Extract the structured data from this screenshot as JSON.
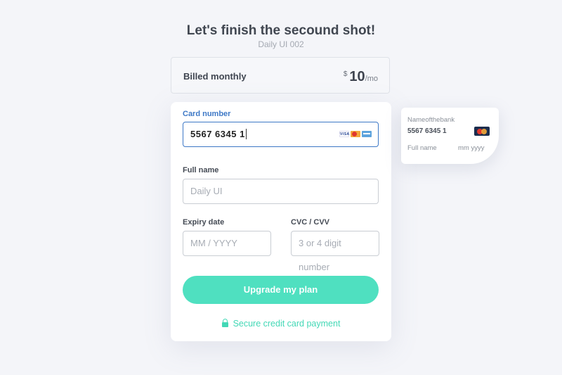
{
  "header": {
    "title": "Let's finish the secound shot!",
    "subtitle": "Daily UI 002"
  },
  "billing": {
    "label": "Billed monthly",
    "currency": "$",
    "amount": "10",
    "period": "/mo"
  },
  "form": {
    "card_number": {
      "label": "Card number",
      "value": "5567  6345  1",
      "brands": [
        "visa-icon",
        "mastercard-icon",
        "amex-icon"
      ]
    },
    "full_name": {
      "label": "Full name",
      "placeholder": "Daily UI"
    },
    "expiry": {
      "label": "Expiry date",
      "placeholder": "MM  /  YYYY"
    },
    "cvc": {
      "label": "CVC / CVV",
      "placeholder": "3 or 4 digit number"
    },
    "submit_label": "Upgrade my plan",
    "secure_label": "Secure credit card payment"
  },
  "preview_card": {
    "bank": "Nameofthebank",
    "number": "5567 6345 1",
    "name": "Full name",
    "expiry": "mm yyyy"
  },
  "colors": {
    "accent": "#4fe0c0",
    "focus": "#3d78c6",
    "background": "#f4f5f9"
  }
}
